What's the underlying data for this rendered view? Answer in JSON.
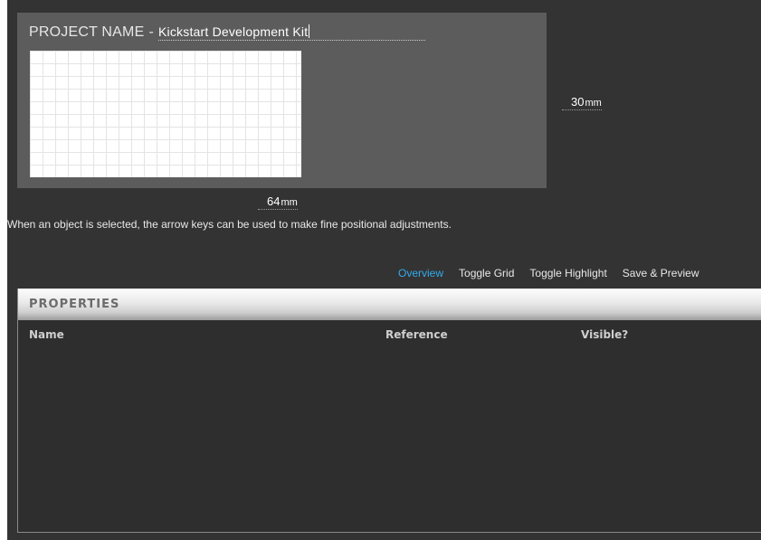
{
  "project": {
    "name_label": "PROJECT NAME",
    "separator": "-",
    "name_value": "Kickstart Development Kit"
  },
  "dimensions": {
    "height_value": "30",
    "width_value": "64",
    "unit": "mm"
  },
  "hint_text": "When an object is selected, the arrow keys can be used to make fine positional adjustments.",
  "toolbar": {
    "items": [
      {
        "label": "Overview",
        "active": true
      },
      {
        "label": "Toggle Grid",
        "active": false
      },
      {
        "label": "Toggle Highlight",
        "active": false
      },
      {
        "label": "Save & Preview",
        "active": false
      }
    ]
  },
  "properties": {
    "title": "PROPERTIES",
    "columns": [
      "Name",
      "Reference",
      "Visible?"
    ]
  },
  "colors": {
    "background": "#333333",
    "panel": "#5c5c5c",
    "accent": "#33aaee",
    "board": "#ffffff"
  }
}
